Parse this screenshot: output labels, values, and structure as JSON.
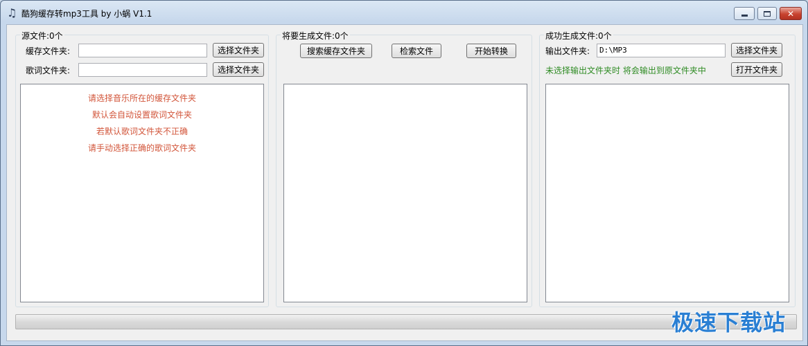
{
  "window": {
    "title": "酷狗缓存转mp3工具 by 小蜗 V1.1",
    "app_icon": "music-note-icon",
    "controls": {
      "minimize": "minimize-icon",
      "maximize": "maximize-icon",
      "close": "close-icon",
      "close_glyph": "✕"
    }
  },
  "source": {
    "group_title": "源文件:0个",
    "cache_folder_label": "缓存文件夹:",
    "cache_folder_value": "",
    "lyrics_folder_label": "歌词文件夹:",
    "lyrics_folder_value": "",
    "select_folder_btn": "选择文件夹",
    "select_folder_btn2": "选择文件夹",
    "hints": [
      "请选择音乐所在的缓存文件夹",
      "默认会自动设置歌词文件夹",
      "若默认歌词文件夹不正确",
      "请手动选择正确的歌词文件夹"
    ],
    "hint_color": "#d2553a"
  },
  "pending": {
    "group_title": "将要生成文件:0个",
    "search_cache_btn": "搜索缓存文件夹",
    "search_files_btn": "检索文件",
    "start_convert_btn": "开始转换"
  },
  "output": {
    "group_title": "成功生成文件:0个",
    "output_folder_label": "输出文件夹:",
    "output_folder_value": "D:\\MP3",
    "select_folder_btn": "选择文件夹",
    "open_folder_btn": "打开文件夹",
    "note": "未选择输出文件夹时 将会输出到原文件夹中",
    "note_color": "#2e8b23"
  },
  "progress": {
    "value": 0
  },
  "watermark": {
    "text": "极速下载站",
    "color": "#2a7fd3"
  }
}
